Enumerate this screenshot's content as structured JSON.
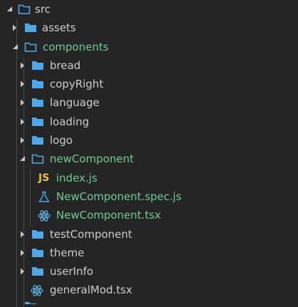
{
  "explorer": {
    "items": [
      {
        "label": "src",
        "type": "folder",
        "open": true,
        "modified": false
      },
      {
        "label": "assets",
        "type": "folder",
        "open": false,
        "modified": false
      },
      {
        "label": "components",
        "type": "folder",
        "open": true,
        "modified": true
      },
      {
        "label": "bread",
        "type": "folder",
        "open": false,
        "modified": false
      },
      {
        "label": "copyRight",
        "type": "folder",
        "open": false,
        "modified": false
      },
      {
        "label": "language",
        "type": "folder",
        "open": false,
        "modified": false
      },
      {
        "label": "loading",
        "type": "folder",
        "open": false,
        "modified": false
      },
      {
        "label": "logo",
        "type": "folder",
        "open": false,
        "modified": false
      },
      {
        "label": "newComponent",
        "type": "folder",
        "open": true,
        "modified": true
      },
      {
        "label": "index.js",
        "type": "js-file",
        "modified": true
      },
      {
        "label": "NewComponent.spec.js",
        "type": "test-file",
        "modified": true
      },
      {
        "label": "NewComponent.tsx",
        "type": "react-file",
        "modified": true
      },
      {
        "label": "testComponent",
        "type": "folder",
        "open": false,
        "modified": false
      },
      {
        "label": "theme",
        "type": "folder",
        "open": false,
        "modified": false
      },
      {
        "label": "userInfo",
        "type": "folder",
        "open": false,
        "modified": false
      },
      {
        "label": "generalMod.tsx",
        "type": "react-file",
        "modified": false
      }
    ],
    "js_badge": "JS"
  },
  "colors": {
    "background": "#252526",
    "text": "#cccccc",
    "modified_text": "#73c991",
    "folder_icon": "#4fa6e8",
    "react_icon": "#61b5e5",
    "js_icon": "#e2c54b",
    "test_icon": "#4fa6e8"
  }
}
